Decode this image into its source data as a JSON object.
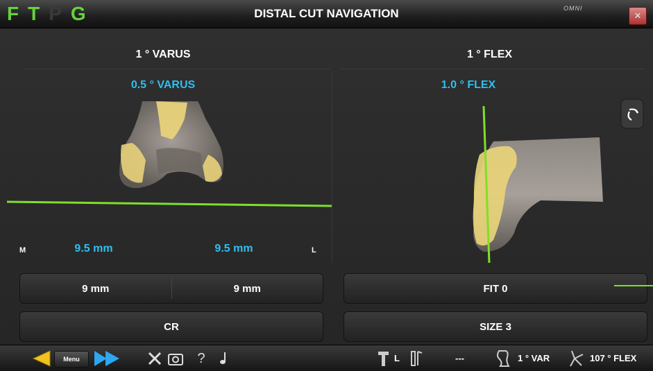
{
  "window": {
    "logo_letters": [
      "F",
      "T",
      "P",
      "G"
    ],
    "logo_colors": [
      "#64d23c",
      "#64d23c",
      "#3a3a3a",
      "#64d23c"
    ],
    "title": "DISTAL CUT NAVIGATION",
    "brand": "OMNI",
    "close_glyph": "×"
  },
  "left_panel": {
    "target_angle": "1 ° VARUS",
    "live_angle": "0.5 ° VARUS",
    "medial_marker": "M",
    "lateral_marker": "L",
    "medial_resection": "9.5 mm",
    "lateral_resection": "9.5 mm",
    "planned_medial": "9 mm",
    "planned_lateral": "9 mm",
    "implant_type": "CR"
  },
  "right_panel": {
    "target_angle": "1 ° FLEX",
    "live_angle": "1.0 ° FLEX",
    "fit": "FIT 0",
    "size": "SIZE 3",
    "rotate_icon": "rotate-view-icon"
  },
  "toolbar": {
    "menu_label": "Menu",
    "side_label": "L",
    "separator_text": "---",
    "varus_reading": "1 ° VAR",
    "flex_reading": "107 ° FLEX"
  },
  "colors": {
    "accent_green": "#7ee02a",
    "live_blue": "#2ec0f0",
    "bone": "#8a8480",
    "cartilage": "#e8d27a"
  }
}
